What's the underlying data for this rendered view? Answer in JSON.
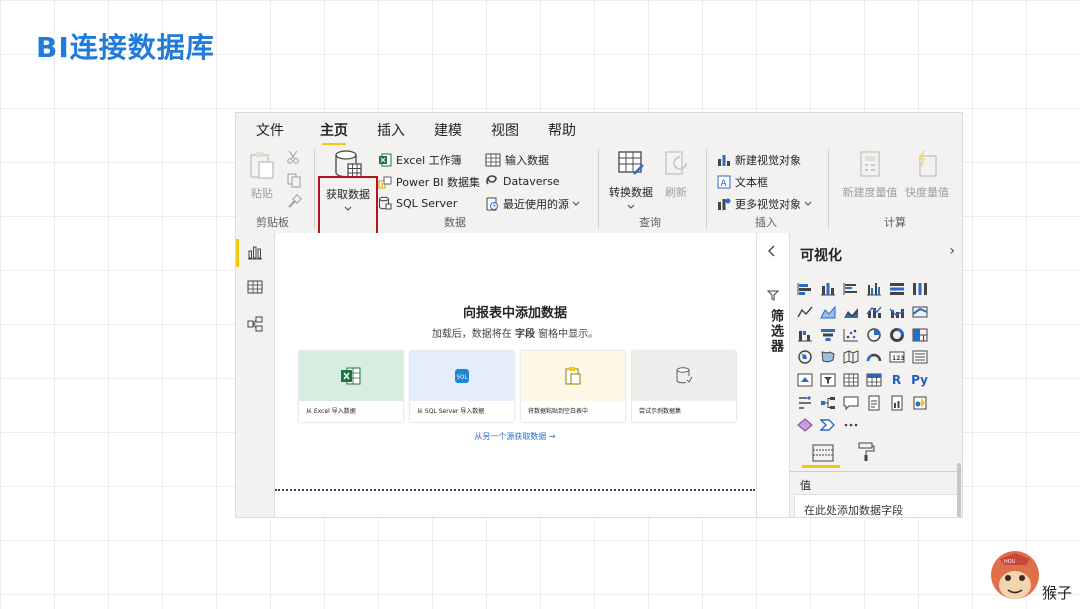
{
  "slide": {
    "title": "BI连接数据库"
  },
  "tabs": [
    {
      "label": "文件"
    },
    {
      "label": "主页"
    },
    {
      "label": "插入"
    },
    {
      "label": "建模"
    },
    {
      "label": "视图"
    },
    {
      "label": "帮助"
    }
  ],
  "ribbon": {
    "clipboard": {
      "paste": "粘贴",
      "group": "剪贴板"
    },
    "data": {
      "get_data": "获取数据",
      "excel": "Excel 工作簿",
      "powerbi": "Power BI 数据集",
      "sql": "SQL Server",
      "enter": "输入数据",
      "dataverse": "Dataverse",
      "recent": "最近使用的源",
      "group": "数据"
    },
    "query": {
      "transform": "转换数据",
      "refresh": "刷新",
      "group": "查询"
    },
    "insert": {
      "new_visual": "新建视觉对象",
      "textbox": "文本框",
      "more_visuals": "更多视觉对象",
      "group": "插入"
    },
    "calc": {
      "new_measure": "新建度量值",
      "quick_measure": "快度量值",
      "group": "计算"
    }
  },
  "canvas": {
    "title": "向报表中添加数据",
    "subtitle_a": "加载后，数据将在 ",
    "subtitle_b": "字段",
    "subtitle_c": " 窗格中显示。",
    "cards": [
      {
        "label": "从 Excel 导入数据",
        "icon": "excel-icon"
      },
      {
        "label": "从 SQL Server 导入数据",
        "icon": "sql-icon"
      },
      {
        "label": "将数据粘贴到空白表中",
        "icon": "paste-icon"
      },
      {
        "label": "尝试示例数据集",
        "icon": "sample-data-icon"
      }
    ],
    "more_sources": "从另一个源获取数据 →"
  },
  "filters": {
    "label": "筛选器"
  },
  "visualizations": {
    "title": "可视化",
    "values_label": "值",
    "values_placeholder": "在此处添加数据字段",
    "r_label": "R",
    "py_label": "Py"
  },
  "brand": {
    "name": "猴子",
    "logo_text": "HOU"
  },
  "colors": {
    "accent": "#f2c811",
    "title_blue": "#1f7bdc",
    "highlight": "#b0171a",
    "excel": "#217346",
    "link": "#2a6bc9"
  }
}
